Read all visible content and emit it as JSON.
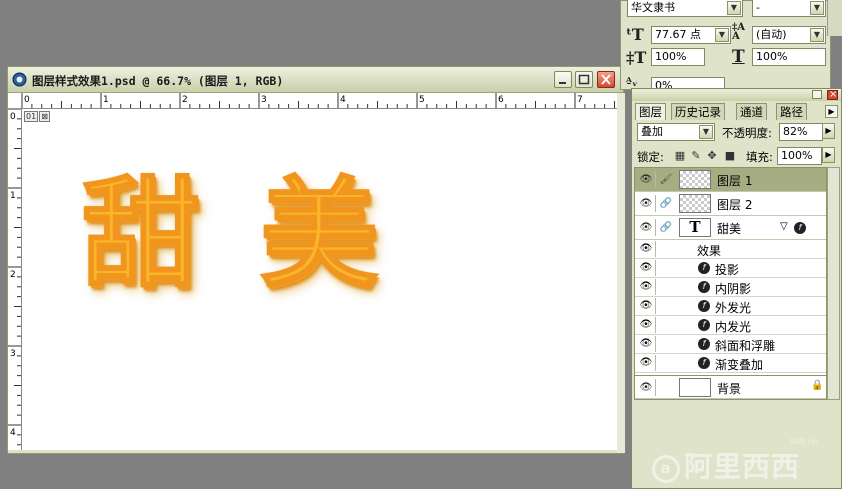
{
  "document": {
    "title": "图层样式效果1.psd @ 66.7% (图层 1, RGB)",
    "ruler_h_labels": [
      "0",
      "1",
      "2",
      "3",
      "4",
      "5",
      "6",
      "7"
    ],
    "ruler_v_labels": [
      "0",
      "1",
      "2",
      "3",
      "4"
    ],
    "canvas_markers": [
      "01",
      "⊠"
    ],
    "artwork_text": "甜美"
  },
  "character": {
    "font_family": "华文隶书",
    "font_style": "-",
    "font_size": "77.67 点",
    "leading": "(自动)",
    "vertical_scale": "100%",
    "horizontal_scale": "100%",
    "tracking": "0%"
  },
  "layers": {
    "tabs": [
      "图层",
      "历史记录",
      "通道",
      "路径"
    ],
    "blend_mode": "叠加",
    "opacity_label": "不透明度:",
    "opacity": "82%",
    "lock_label": "锁定:",
    "fill_label": "填充:",
    "fill": "100%",
    "rows": [
      {
        "name": "图层 1",
        "type": "pixel",
        "selected": true
      },
      {
        "name": "图层 2",
        "type": "pixel",
        "selected": false
      },
      {
        "name": "甜美",
        "type": "text",
        "selected": false
      }
    ],
    "effects_header": "效果",
    "effects": [
      "投影",
      "内阴影",
      "外发光",
      "内发光",
      "斜面和浮雕",
      "渐变叠加"
    ],
    "background": "背景"
  },
  "watermark": {
    "logo": "a",
    "text": "阿里西西",
    "sub": "988.cn"
  }
}
